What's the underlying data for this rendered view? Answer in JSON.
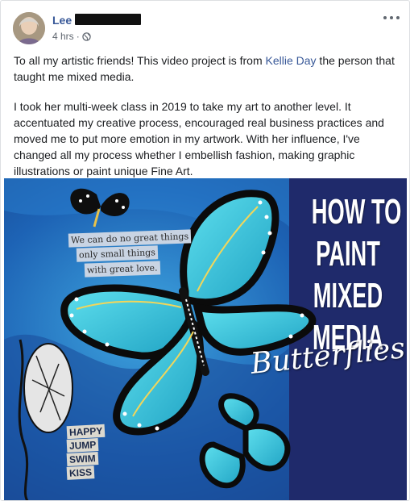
{
  "post": {
    "author": "Lee",
    "time": "4 hrs",
    "separator": "·",
    "privacy_icon": "globe-icon",
    "more_icon": "more-horizontal-icon",
    "paragraph1": {
      "before": "To all my artistic friends! This video project is from ",
      "link": "Kellie Day",
      "after": " the person that taught me mixed media."
    },
    "paragraph2": "I took her multi-week class in 2019 to take my art to another level. It accentuated my creative process, encouraged real business practices and moved me to put more emotion in my artwork. With her influence, I've changed all my process whether I embellish fashion, making graphic illustrations or paint unique Fine Art."
  },
  "media": {
    "title_lines": [
      "HOW TO",
      "PAINT",
      "MIXED",
      "MEDIA"
    ],
    "script_word": "Butterflies",
    "quote_lines": [
      "We can do no great things",
      "only small things",
      "with great love."
    ],
    "words": [
      "HAPPY",
      "JUMP",
      "SWIM",
      "KISS"
    ],
    "colors": {
      "background_blue": "#1d63b5",
      "butterfly_teal": "#39c1d6",
      "panel_navy": "#1f2a6b",
      "link_blue": "#385898"
    }
  }
}
